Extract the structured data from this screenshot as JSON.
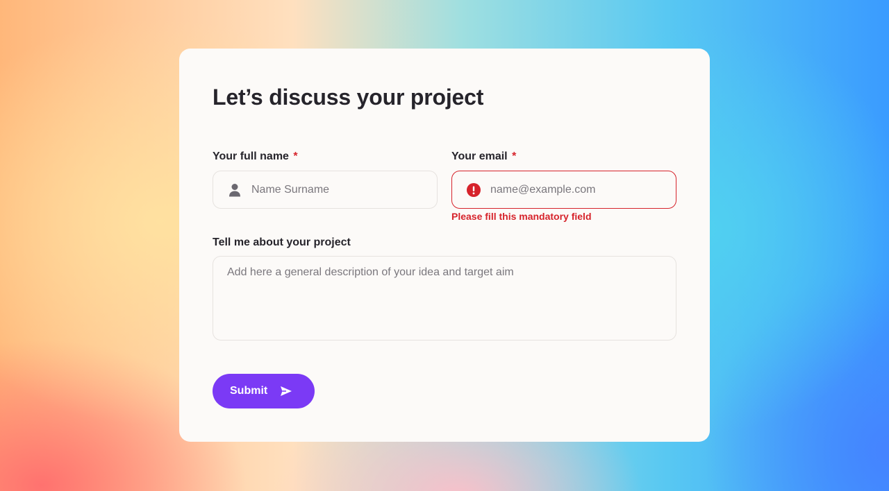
{
  "form": {
    "title": "Let’s discuss your project",
    "name_field": {
      "label": "Your full name",
      "required_mark": "*",
      "placeholder": "Name Surname",
      "icon": "user-icon"
    },
    "email_field": {
      "label": "Your email",
      "required_mark": "*",
      "placeholder": "name@example.com",
      "icon": "error-icon",
      "error_message": "Please fill this mandatory field"
    },
    "project_field": {
      "label": "Tell me about your project",
      "placeholder": "Add here a general description of your idea and target aim"
    },
    "submit": {
      "label": "Submit",
      "icon": "send-icon"
    }
  },
  "colors": {
    "accent": "#7b3af5",
    "error": "#d6232b",
    "card_background": "#fcfaf8",
    "text": "#26242b"
  }
}
